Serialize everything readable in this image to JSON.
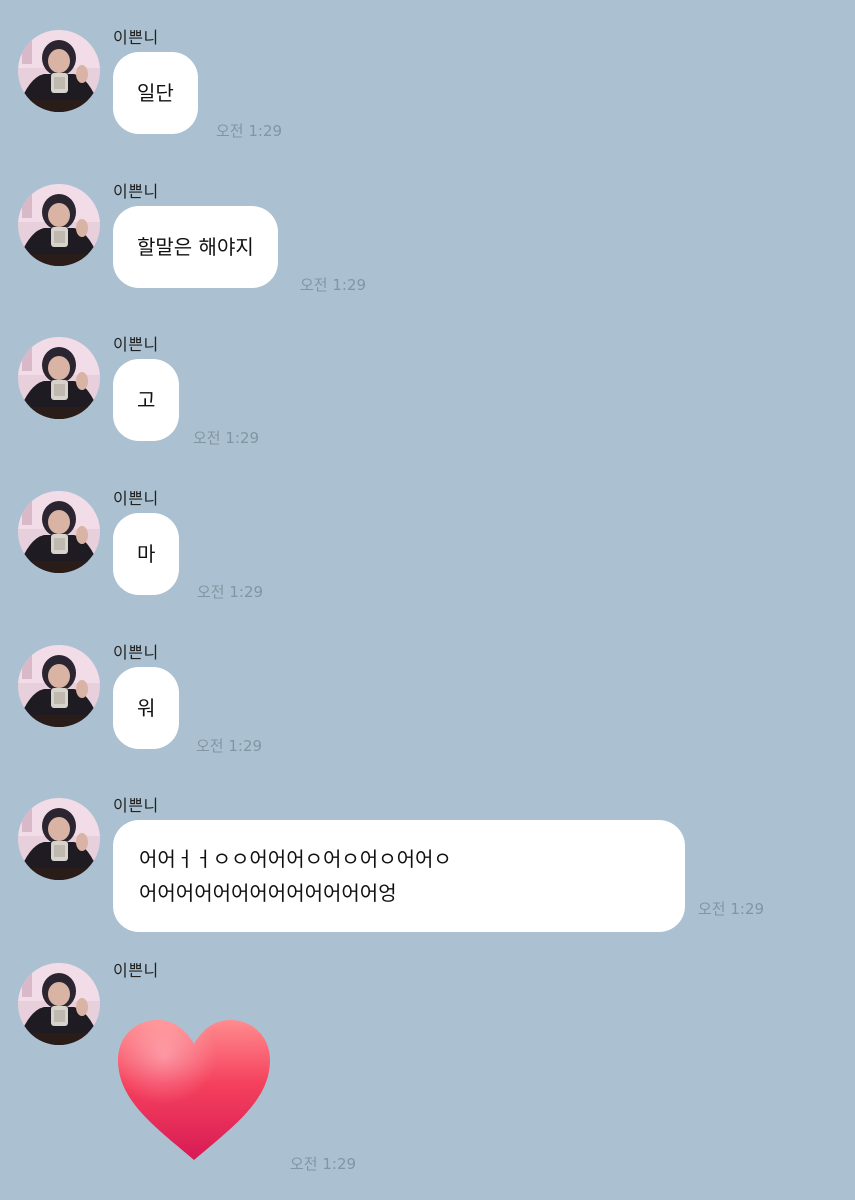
{
  "chat": {
    "sender_name": "이쁜니",
    "messages": [
      {
        "text": "일단",
        "time": "오전 1:29"
      },
      {
        "text": "할말은 해야지",
        "time": "오전 1:29"
      },
      {
        "text": "고",
        "time": "오전 1:29"
      },
      {
        "text": "마",
        "time": "오전 1:29"
      },
      {
        "text": "워",
        "time": "오전 1:29"
      },
      {
        "line1": "어어ㅓㅓㅇㅇ어어어ㅇ어ㅇ어ㅇ어어ㅇ",
        "line2": "어어어어어어어어어어어어어엉",
        "time": "오전 1:29"
      },
      {
        "emoji": "heart",
        "time": "오전 1:29"
      }
    ]
  },
  "icons": {
    "avatar": "profile-photo",
    "heart": "red-heart-emoji"
  },
  "colors": {
    "background": "#abc1d1",
    "bubble": "#ffffff",
    "time_text": "#8395a3",
    "heart": "#f23f5f"
  }
}
